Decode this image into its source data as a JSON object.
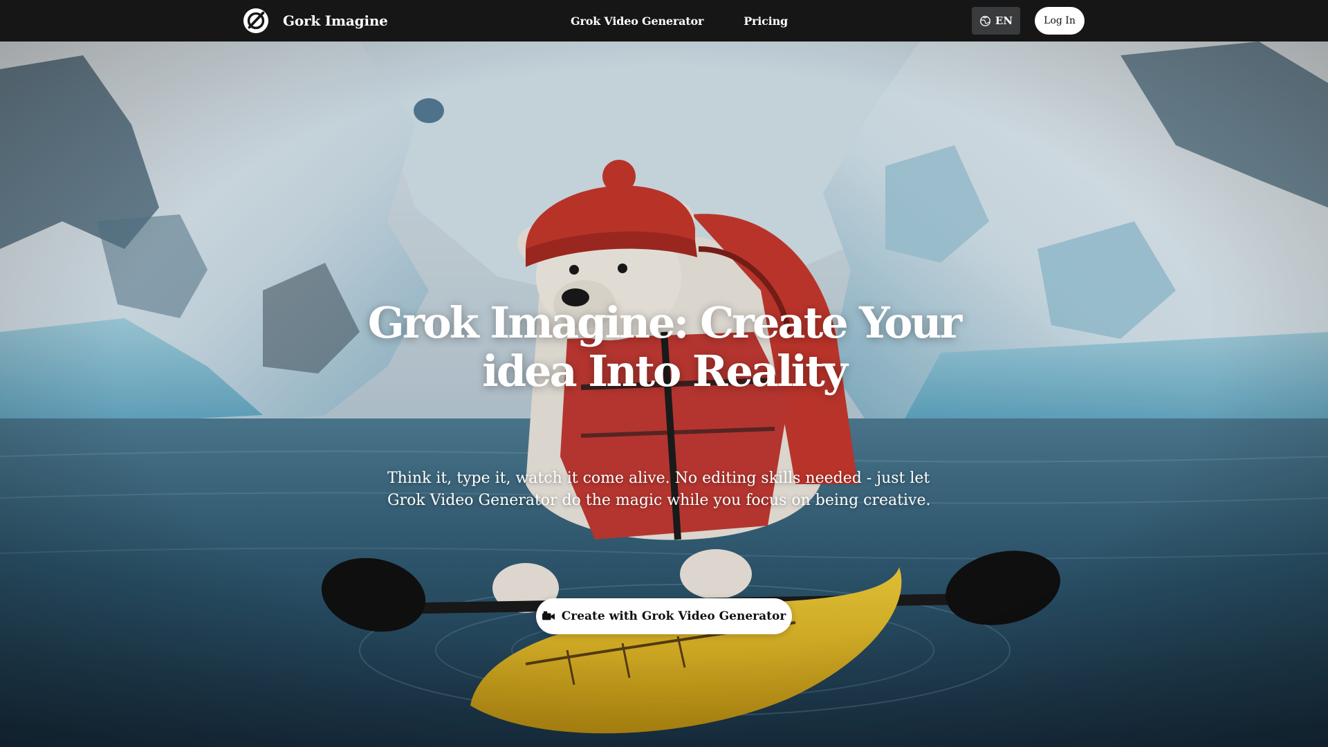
{
  "brand": {
    "name": "Gork Imagine",
    "logo_icon": "logo-mark-icon"
  },
  "nav": {
    "items": [
      {
        "label": "Grok Video Generator"
      },
      {
        "label": "Pricing"
      }
    ]
  },
  "header": {
    "language_label": "EN",
    "language_icon": "globe-icon",
    "login_label": "Log In"
  },
  "hero": {
    "title": "Grok Imagine: Create Your idea Into Reality",
    "subtitle": "Think it, type it, watch it come alive. No editing skills needed - just let Grok Video Generator do the magic while you focus on being creative.",
    "cta_label": "Create with Grok Video Generator",
    "cta_icon": "video-camera-icon"
  },
  "colors": {
    "header_bg": "#161616",
    "accent": "#ffffff",
    "lang_button_bg": "#3a3b3d",
    "button_text": "#111111"
  }
}
